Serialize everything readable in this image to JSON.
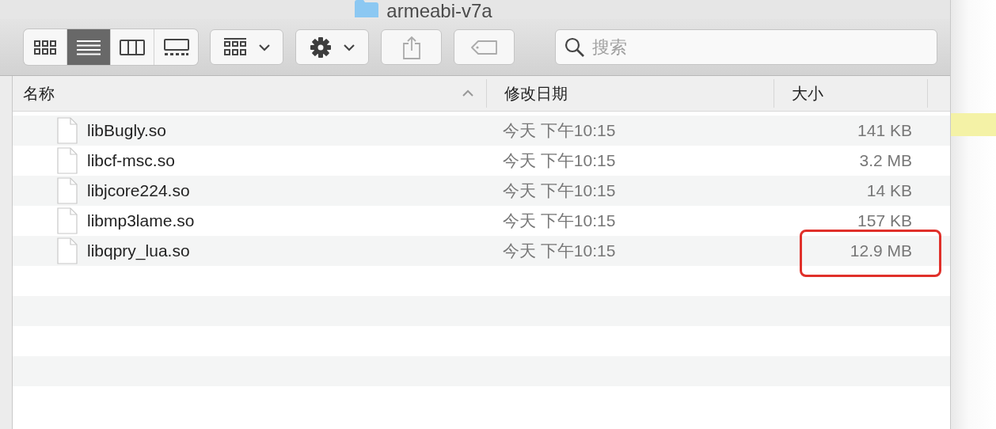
{
  "window": {
    "title": "armeabi-v7a"
  },
  "view_modes": [
    {
      "kind": "icons",
      "selected": false
    },
    {
      "kind": "list",
      "selected": true
    },
    {
      "kind": "columns",
      "selected": false
    },
    {
      "kind": "gallery",
      "selected": false
    }
  ],
  "search": {
    "placeholder": "搜索"
  },
  "columns": [
    {
      "label": "名称",
      "sorted": true
    },
    {
      "label": "修改日期",
      "sorted": false
    },
    {
      "label": "大小",
      "sorted": false
    }
  ],
  "rows": [
    {
      "name": "libBugly.so",
      "date": "今天 下午10:15",
      "size": "141 KB",
      "highlighted": false
    },
    {
      "name": "libcf-msc.so",
      "date": "今天 下午10:15",
      "size": "3.2 MB",
      "highlighted": false
    },
    {
      "name": "libjcore224.so",
      "date": "今天 下午10:15",
      "size": "14 KB",
      "highlighted": false
    },
    {
      "name": "libmp3lame.so",
      "date": "今天 下午10:15",
      "size": "157 KB",
      "highlighted": false
    },
    {
      "name": "libqpry_lua.so",
      "date": "今天 下午10:15",
      "size": "12.9 MB",
      "highlighted": true
    }
  ]
}
